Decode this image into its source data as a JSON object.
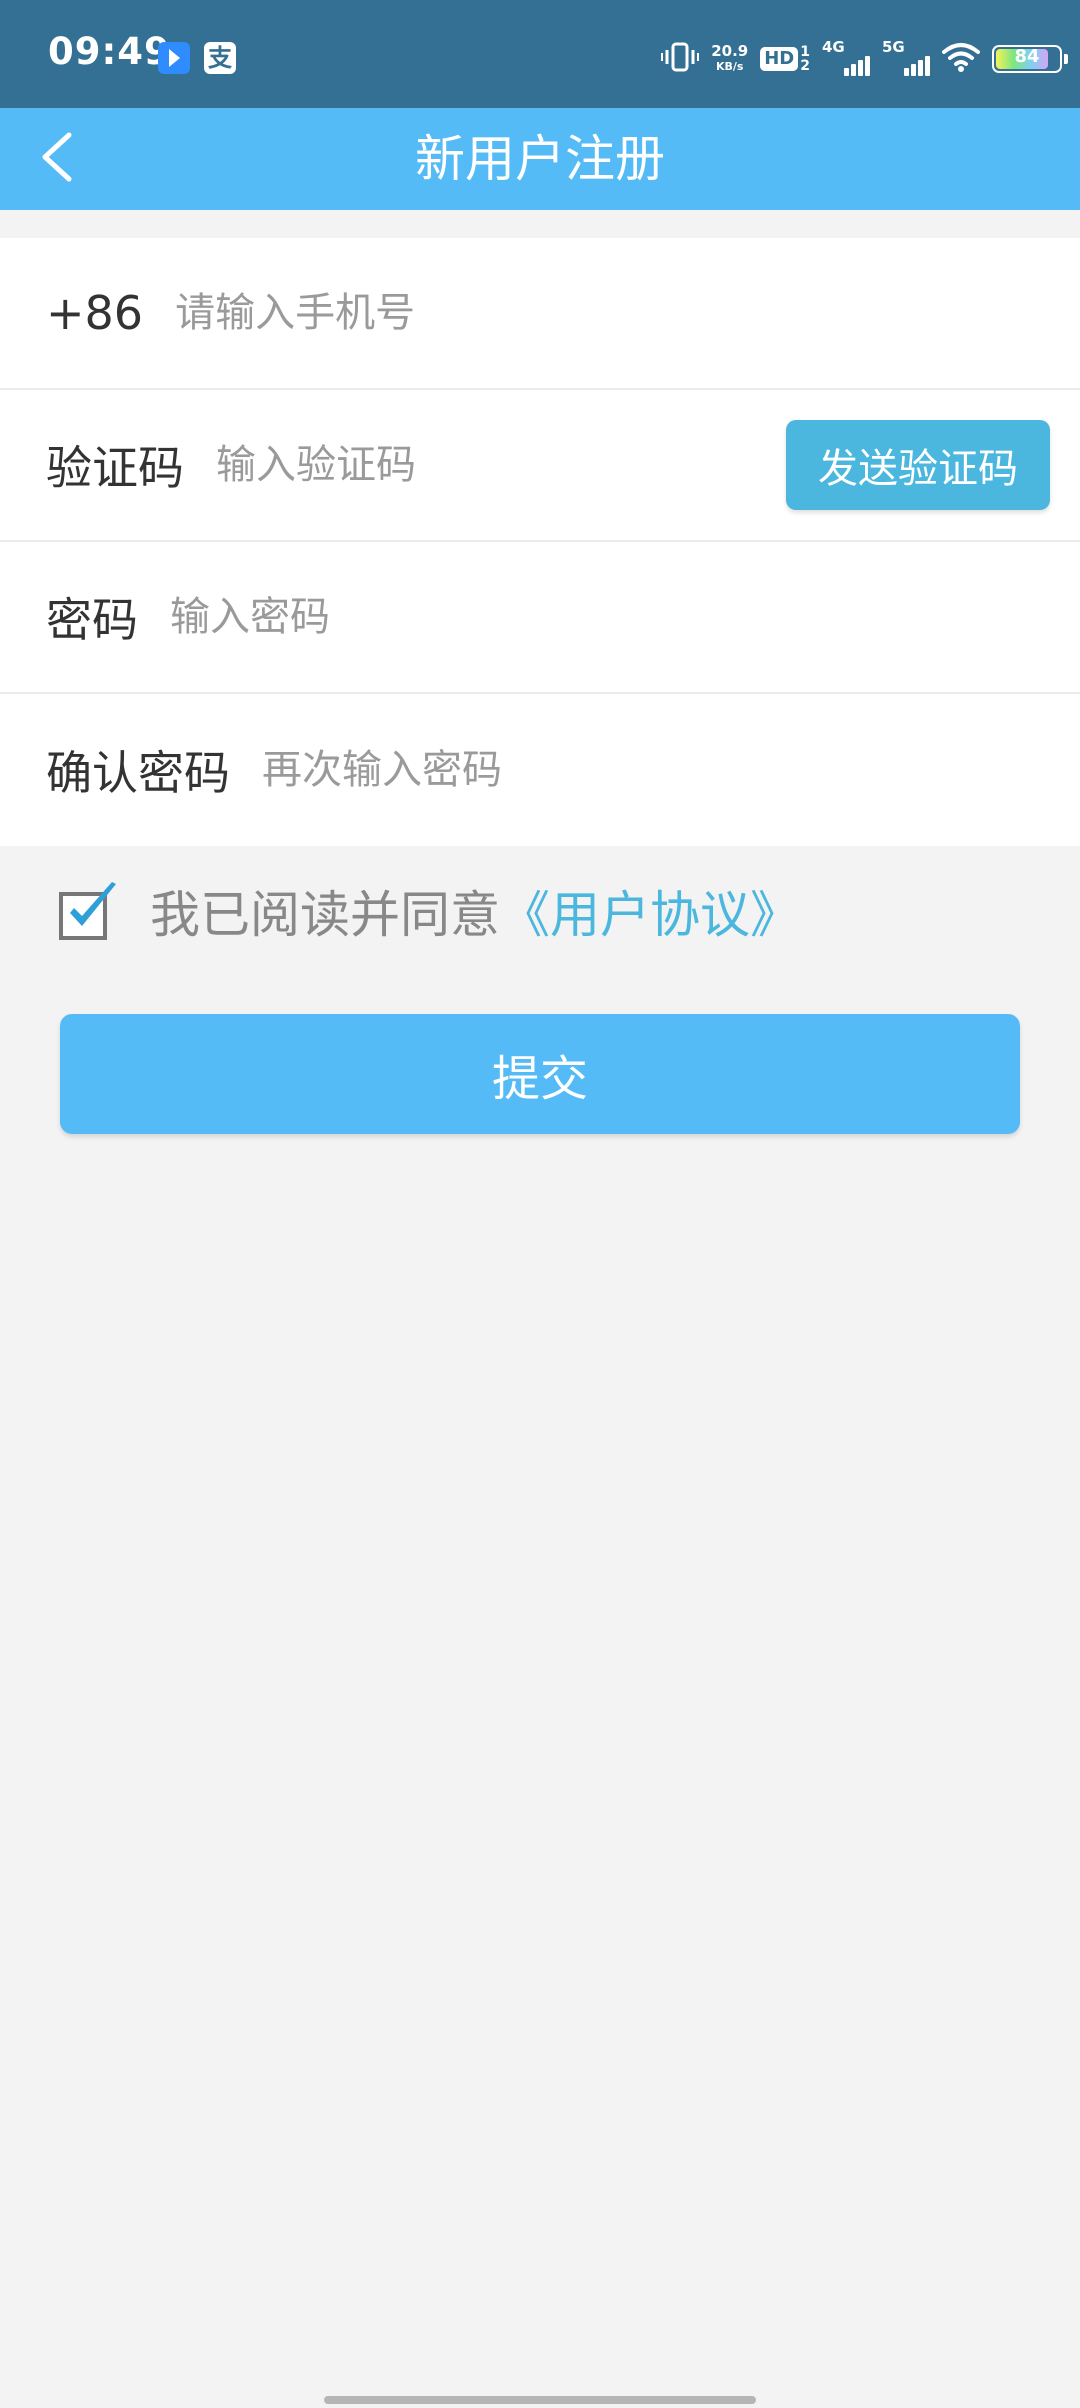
{
  "status_bar": {
    "time": "09:49",
    "app_icons": [
      "blue-arrow-app-icon",
      "alipay-icon"
    ],
    "alipay_glyph": "支",
    "net_speed_value": "20.9",
    "net_speed_unit": "KB/s",
    "hd_label": "HD",
    "hd_sim1": "1",
    "hd_sim2": "2",
    "signal1_label": "4G",
    "signal2_label": "5G",
    "battery_level": "84"
  },
  "header": {
    "title": "新用户注册",
    "back_icon": "chevron-left-icon"
  },
  "form": {
    "phone": {
      "prefix": "+86",
      "placeholder": "请输入手机号",
      "value": ""
    },
    "code": {
      "label": "验证码",
      "placeholder": "输入验证码",
      "value": "",
      "send_button_label": "发送验证码"
    },
    "password": {
      "label": "密码",
      "placeholder": "输入密码",
      "value": ""
    },
    "confirm_password": {
      "label": "确认密码",
      "placeholder": "再次输入密码",
      "value": ""
    }
  },
  "agreement": {
    "checked": true,
    "text": "我已阅读并同意",
    "link_text": "《用户协议》"
  },
  "submit": {
    "label": "提交"
  },
  "colors": {
    "status_bar": "#337093",
    "header": "#55bbf6",
    "accent": "#4cb7de",
    "background": "#f3f3f3"
  }
}
